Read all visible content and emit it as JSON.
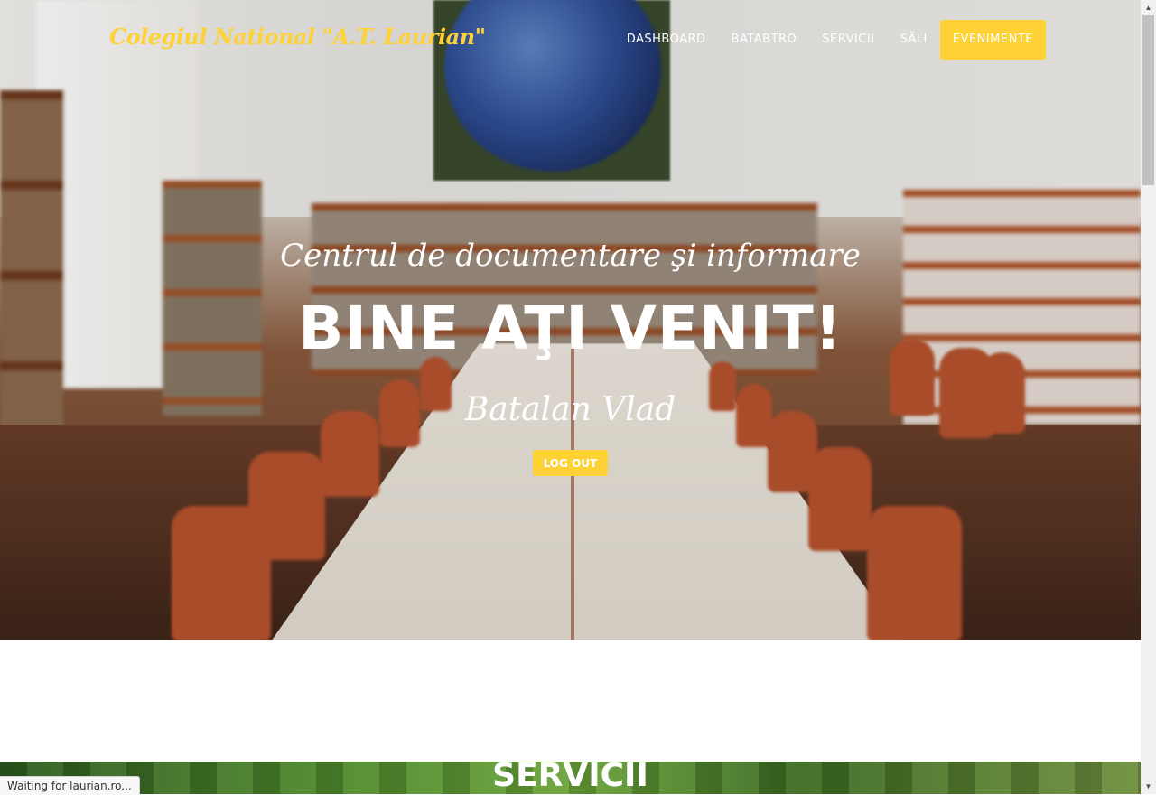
{
  "brand": {
    "name": "Colegiul National \"A.T. Laurian\""
  },
  "nav": {
    "items": [
      {
        "label": "DASHBOARD"
      },
      {
        "label": "BATABTRO"
      },
      {
        "label": "SERVICII"
      },
      {
        "label": "SĂLI"
      },
      {
        "label": "EVENIMENTE",
        "active": true
      }
    ]
  },
  "hero": {
    "lead": "Centrul de documentare şi informare",
    "heading": "BINE AŢI VENIT!",
    "user_name": "Batalan Vlad",
    "logout_label": "LOG OUT"
  },
  "services": {
    "title": "SERVICII"
  },
  "status_bar": {
    "text": "Waiting for laurian.ro..."
  },
  "colors": {
    "accent": "#fed136",
    "text_light": "#ffffff"
  },
  "scrollbar": {
    "up_icon": "arrow-up-icon",
    "down_icon": "arrow-down-icon"
  }
}
